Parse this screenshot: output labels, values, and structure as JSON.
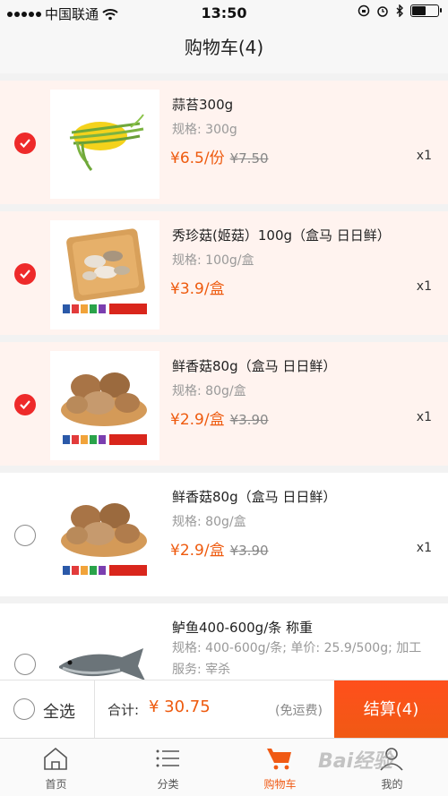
{
  "status_bar": {
    "carrier": "中国联通",
    "time": "13:50"
  },
  "nav": {
    "title": "购物车(4)"
  },
  "items": [
    {
      "name": "蒜苔300g",
      "spec": "规格: 300g",
      "price": "¥6.5/份",
      "orig_price": "¥7.50",
      "qty": "x1",
      "selected": true,
      "image": "garlic-scapes"
    },
    {
      "name": "秀珍菇(姬菇）100g（盒马 日日鲜）",
      "spec": "规格: 100g/盒",
      "price": "¥3.9/盒",
      "orig_price": "",
      "qty": "x1",
      "selected": true,
      "image": "oyster-mushrooms"
    },
    {
      "name": "鲜香菇80g（盒马 日日鲜）",
      "spec": "规格: 80g/盒",
      "price": "¥2.9/盒",
      "orig_price": "¥3.90",
      "qty": "x1",
      "selected": true,
      "image": "shiitake-mushrooms"
    },
    {
      "name": "鲜香菇80g（盒马 日日鲜）",
      "spec": "规格: 80g/盒",
      "price": "¥2.9/盒",
      "orig_price": "¥3.90",
      "qty": "x1",
      "selected": false,
      "image": "shiitake-mushrooms"
    },
    {
      "name": "鲈鱼400-600g/条 称重",
      "spec": "规格: 400-600g/条; 单价: 25.9/500g; 加工服务: 宰杀",
      "price": "",
      "orig_price": "",
      "qty": "",
      "selected": false,
      "image": "sea-bass"
    }
  ],
  "footer": {
    "select_all": "全选",
    "total_label": "合计:",
    "total_value": "¥ 30.75",
    "free_shipping": "(免运费)",
    "checkout": "结算(4)"
  },
  "tabs": [
    {
      "label": "首页",
      "icon": "home-icon"
    },
    {
      "label": "分类",
      "icon": "list-icon"
    },
    {
      "label": "购物车",
      "icon": "cart-icon",
      "active": true
    },
    {
      "label": "我的",
      "icon": "profile-icon"
    }
  ],
  "watermark": "Bai经验",
  "colors": {
    "accent": "#f05a14",
    "check_red": "#ee2a2a",
    "selected_bg": "#fff3ef"
  }
}
